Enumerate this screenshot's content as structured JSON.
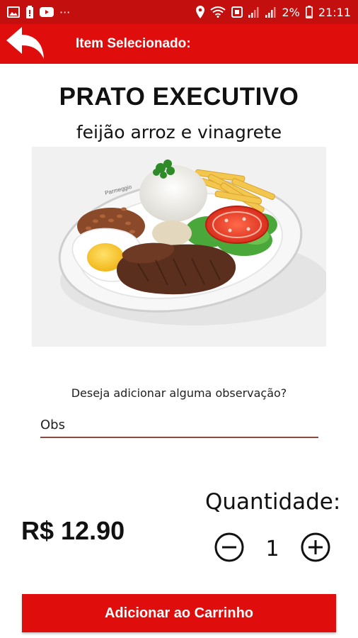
{
  "status_bar": {
    "battery_percent": "2%",
    "time": "21:11",
    "overflow": "···",
    "left_icons": [
      "image-icon",
      "battery-notification-icon",
      "youtube-icon"
    ],
    "right_icons": [
      "location-icon",
      "wifi-icon",
      "nfc-icon",
      "signal-icon",
      "signal-icon",
      "battery-icon"
    ]
  },
  "header": {
    "title": "Item Selecionado:",
    "back_icon": "back-arrow-icon"
  },
  "product": {
    "name": "PRATO EXECUTIVO",
    "description": "feijão arroz e vinagrete",
    "image_label": "Parmeggio",
    "price": "R$ 12.90"
  },
  "observation": {
    "question": "Deseja adicionar alguma observação?",
    "placeholder": "Obs",
    "value": ""
  },
  "quantity": {
    "label": "Quantidade:",
    "value": "1"
  },
  "actions": {
    "add_to_cart": "Adicionar ao Carrinho"
  },
  "colors": {
    "status_bar": "#c40f0f",
    "accent": "#e00d0d",
    "input_underline": "#8b4a3c"
  }
}
